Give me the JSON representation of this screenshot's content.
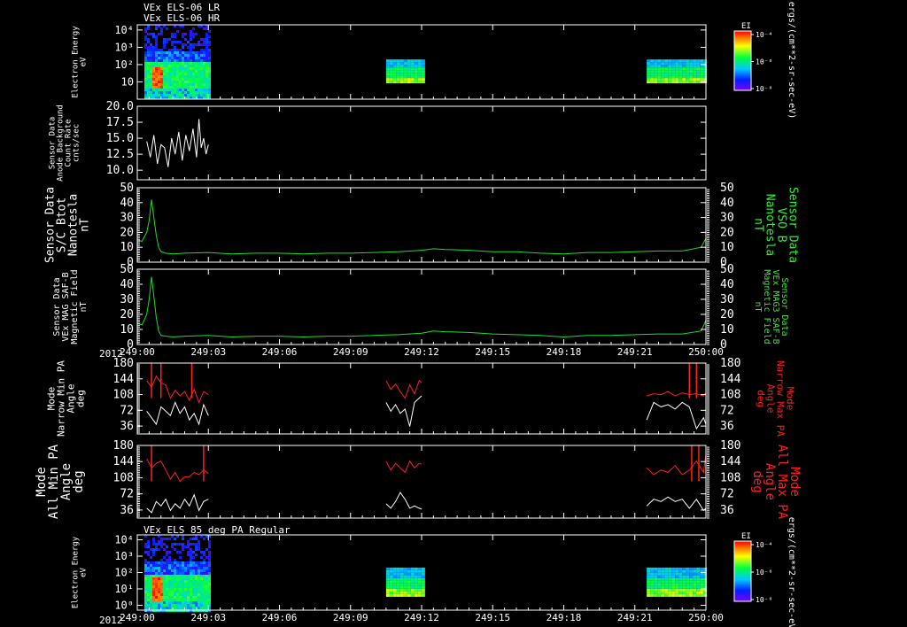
{
  "header": {
    "line1": "VEx ELS-06 LR",
    "line2": "VEx ELS-06 HR",
    "bottom_title": "VEx ELS 85 deg PA Regular"
  },
  "colors": {
    "background": "#000000",
    "axis": "#ffffff",
    "white_trace": "#ffffff",
    "green_trace": "#22dd22",
    "red_trace": "#ff2020",
    "green_label": "#33ee33",
    "red_label": "#ff2020"
  },
  "time_axis": {
    "year": "2012",
    "ticks": [
      "249:00",
      "249:03",
      "249:06",
      "249:09",
      "249:12",
      "249:15",
      "249:18",
      "249:21",
      "250:00"
    ],
    "range_minutes": [
      0,
      24
    ]
  },
  "chart_data": [
    {
      "id": "panel1",
      "type": "heatmap",
      "title": "VEx ELS-06 LR / VEx ELS-06 HR",
      "ylabel": [
        "Electron Energy",
        "eV"
      ],
      "yscale": "log",
      "ylim": [
        1,
        20000
      ],
      "yticks": [
        {
          "v": 10,
          "t": "10"
        },
        {
          "v": 100,
          "t": "10²"
        },
        {
          "v": 1000,
          "t": "10³"
        },
        {
          "v": 10000,
          "t": "10⁴"
        }
      ],
      "blocks": [
        {
          "x": [
            0.3,
            3.0
          ],
          "e": [
            1,
            20000
          ],
          "kind": "dense"
        },
        {
          "x": [
            10.5,
            12.0
          ],
          "e": [
            9,
            200
          ],
          "kind": "band"
        },
        {
          "x": [
            21.5,
            24.0
          ],
          "e": [
            9,
            200
          ],
          "kind": "band"
        }
      ],
      "colorbar": {
        "label": "EI",
        "ticks": [
          "10⁻⁴",
          "10⁻⁶",
          "10⁻⁸"
        ],
        "unit": "ergs/(cm**2-sr-sec-eV)"
      }
    },
    {
      "id": "panel2",
      "type": "line",
      "ylabel": [
        "Sensor Data",
        "Anode Background",
        "Count Rate",
        "cnts/sec"
      ],
      "ylim": [
        8.5,
        20
      ],
      "yticks": [
        {
          "v": 10,
          "t": "10.0"
        },
        {
          "v": 12.5,
          "t": "12.5"
        },
        {
          "v": 15,
          "t": "15.0"
        },
        {
          "v": 17.5,
          "t": "17.5"
        },
        {
          "v": 20,
          "t": "20.0"
        }
      ],
      "series": [
        {
          "color": "white",
          "x": [
            0.4,
            0.55,
            0.7,
            0.85,
            1.0,
            1.15,
            1.3,
            1.45,
            1.6,
            1.75,
            1.9,
            2.05,
            2.2,
            2.35,
            2.5,
            2.6,
            2.7,
            2.8,
            2.9,
            3.0
          ],
          "y": [
            14.5,
            12.0,
            15.5,
            11.0,
            14.0,
            13.5,
            10.5,
            15.0,
            12.5,
            16.0,
            11.5,
            15.5,
            13.0,
            16.5,
            12.0,
            18.0,
            13.5,
            15.0,
            12.5,
            14.0
          ]
        }
      ]
    },
    {
      "id": "panel3",
      "type": "line",
      "ylabel": [
        "Sensor Data",
        "S/C Btot",
        "Nanotesla",
        "nT"
      ],
      "right_label": [
        "Sensor Data",
        "VSO B",
        "Nanotesla",
        "nT"
      ],
      "ylim": [
        0,
        50
      ],
      "yticks": [
        {
          "v": 10,
          "t": "10"
        },
        {
          "v": 20,
          "t": "20"
        },
        {
          "v": 30,
          "t": "30"
        },
        {
          "v": 40,
          "t": "40"
        },
        {
          "v": 50,
          "t": "50"
        }
      ],
      "series": [
        {
          "color": "green",
          "x": [
            0,
            0.2,
            0.4,
            0.5,
            0.6,
            0.7,
            0.8,
            0.9,
            1.0,
            1.2,
            1.5,
            2.0,
            3.0,
            4.0,
            5.0,
            6.0,
            7.0,
            8.0,
            9.0,
            10.0,
            11.0,
            12.0,
            12.5,
            13.0,
            14.0,
            15.0,
            16.0,
            17.0,
            18.0,
            19.0,
            20.0,
            21.0,
            22.0,
            23.0,
            23.8,
            24.0
          ],
          "y": [
            15,
            14,
            20,
            28,
            42,
            30,
            18,
            10,
            7,
            6,
            5.5,
            6,
            6.5,
            5.5,
            6,
            6,
            5.5,
            6,
            6,
            6.5,
            7,
            8,
            9,
            8.5,
            8,
            7,
            7,
            6,
            5.5,
            6.5,
            6.5,
            7,
            7.5,
            7.5,
            10,
            16
          ]
        }
      ]
    },
    {
      "id": "panel4",
      "type": "line",
      "ylabel": [
        "Sensor Data",
        "VEx MAG SAF-B",
        "Magnetic Field",
        "nT"
      ],
      "right_label": [
        "Sensor Data",
        "VEx MAG3 SAF-B",
        "Magnetic Field",
        "nT"
      ],
      "ylim": [
        0,
        50
      ],
      "yticks": [
        {
          "v": 10,
          "t": "10"
        },
        {
          "v": 20,
          "t": "20"
        },
        {
          "v": 30,
          "t": "30"
        },
        {
          "v": 40,
          "t": "40"
        },
        {
          "v": 50,
          "t": "50"
        }
      ],
      "series": [
        {
          "color": "green",
          "x": [
            0,
            0.2,
            0.4,
            0.5,
            0.6,
            0.7,
            0.8,
            0.9,
            1.0,
            1.2,
            1.5,
            2.0,
            3.0,
            4.0,
            5.0,
            6.0,
            7.0,
            8.0,
            9.0,
            10.0,
            11.0,
            12.0,
            12.5,
            13.0,
            14.0,
            15.0,
            16.0,
            17.0,
            18.0,
            19.0,
            20.0,
            21.0,
            22.0,
            23.0,
            23.8,
            24.0
          ],
          "y": [
            14,
            13,
            20,
            30,
            45,
            32,
            18,
            9,
            6,
            5.5,
            5,
            5.5,
            6,
            5,
            5.5,
            5.5,
            5,
            5.5,
            5.5,
            6,
            6.5,
            7.5,
            9,
            8.5,
            8,
            7,
            6.5,
            6,
            5,
            6,
            6,
            6.5,
            7,
            7,
            9,
            16
          ]
        }
      ]
    },
    {
      "id": "panel5",
      "type": "line",
      "ylabel": [
        "Mode",
        "Narrow Min PA",
        "Angle",
        "deg"
      ],
      "right_label": [
        "Mode",
        "Narrow Max PA",
        "Angle",
        "deg"
      ],
      "ylim": [
        18,
        180
      ],
      "yticks": [
        {
          "v": 36,
          "t": "36"
        },
        {
          "v": 72,
          "t": "72"
        },
        {
          "v": 108,
          "t": "108"
        },
        {
          "v": 144,
          "t": "144"
        },
        {
          "v": 180,
          "t": "180"
        }
      ],
      "series": [
        {
          "color": "red",
          "segments": [
            {
              "x": [
                0.4,
                0.6,
                0.8,
                1.0,
                1.2,
                1.4,
                1.6,
                1.8,
                2.0,
                2.2,
                2.4,
                2.6,
                2.8,
                3.0
              ],
              "y": [
                140,
                125,
                150,
                135,
                130,
                100,
                118,
                105,
                115,
                95,
                120,
                90,
                115,
                108
              ]
            },
            {
              "x": [
                10.5,
                10.7,
                10.9,
                11.1,
                11.3,
                11.5,
                11.7,
                11.9,
                12.0
              ],
              "y": [
                140,
                120,
                132,
                115,
                100,
                130,
                110,
                140,
                135
              ]
            },
            {
              "x": [
                21.5,
                21.8,
                22.1,
                22.4,
                22.7,
                23.0,
                23.3,
                23.6,
                23.9,
                24.0
              ],
              "y": [
                105,
                110,
                108,
                115,
                105,
                112,
                108,
                110,
                105,
                112
              ]
            }
          ],
          "spikes": [
            0.6,
            1.0,
            2.3,
            23.3,
            23.6
          ]
        },
        {
          "color": "white",
          "segments": [
            {
              "x": [
                0.4,
                0.6,
                0.8,
                1.0,
                1.2,
                1.4,
                1.6,
                1.8,
                2.0,
                2.2,
                2.4,
                2.6,
                2.8,
                3.0
              ],
              "y": [
                70,
                55,
                40,
                80,
                70,
                60,
                90,
                65,
                80,
                50,
                65,
                40,
                85,
                60
              ]
            },
            {
              "x": [
                10.5,
                10.7,
                10.9,
                11.1,
                11.3,
                11.5,
                11.7,
                11.9,
                12.0
              ],
              "y": [
                90,
                70,
                85,
                65,
                75,
                35,
                90,
                100,
                105
              ]
            },
            {
              "x": [
                21.5,
                21.8,
                22.1,
                22.4,
                22.7,
                23.0,
                23.3,
                23.6,
                23.9,
                24.0
              ],
              "y": [
                50,
                90,
                80,
                85,
                75,
                90,
                80,
                30,
                55,
                40
              ]
            }
          ]
        }
      ]
    },
    {
      "id": "panel6",
      "type": "line",
      "ylabel": [
        "Mode",
        "All Min PA",
        "Angle",
        "deg"
      ],
      "right_label": [
        "Mode",
        "All Max PA",
        "Angle",
        "deg"
      ],
      "ylim": [
        18,
        180
      ],
      "yticks": [
        {
          "v": 36,
          "t": "36"
        },
        {
          "v": 72,
          "t": "72"
        },
        {
          "v": 108,
          "t": "108"
        },
        {
          "v": 144,
          "t": "144"
        },
        {
          "v": 180,
          "t": "180"
        }
      ],
      "series": [
        {
          "color": "red",
          "segments": [
            {
              "x": [
                0.4,
                0.6,
                0.8,
                1.0,
                1.2,
                1.4,
                1.6,
                1.8,
                2.0,
                2.2,
                2.4,
                2.6,
                2.8,
                3.0
              ],
              "y": [
                150,
                130,
                140,
                145,
                125,
                105,
                120,
                100,
                110,
                110,
                120,
                115,
                125,
                118
              ]
            },
            {
              "x": [
                10.5,
                10.7,
                10.9,
                11.1,
                11.3,
                11.5,
                11.7,
                11.9,
                12.0
              ],
              "y": [
                145,
                125,
                140,
                130,
                120,
                145,
                130,
                140,
                138
              ]
            },
            {
              "x": [
                21.5,
                21.8,
                22.1,
                22.4,
                22.7,
                23.0,
                23.3,
                23.6,
                23.9,
                24.0
              ],
              "y": [
                130,
                115,
                125,
                120,
                135,
                115,
                125,
                145,
                120,
                160
              ]
            }
          ],
          "spikes": [
            0.6,
            2.8,
            23.4,
            23.7
          ]
        },
        {
          "color": "white",
          "segments": [
            {
              "x": [
                0.4,
                0.6,
                0.8,
                1.0,
                1.2,
                1.4,
                1.6,
                1.8,
                2.0,
                2.2,
                2.4,
                2.6,
                2.8,
                3.0
              ],
              "y": [
                40,
                30,
                55,
                45,
                60,
                35,
                50,
                40,
                60,
                45,
                70,
                35,
                55,
                60
              ]
            },
            {
              "x": [
                10.5,
                10.7,
                10.9,
                11.1,
                11.3,
                11.5,
                11.7,
                11.9,
                12.0
              ],
              "y": [
                50,
                40,
                55,
                75,
                60,
                40,
                45,
                40,
                38
              ]
            },
            {
              "x": [
                21.5,
                21.8,
                22.1,
                22.4,
                22.7,
                23.0,
                23.3,
                23.6,
                23.9,
                24.0
              ],
              "y": [
                45,
                60,
                55,
                65,
                55,
                60,
                40,
                60,
                35,
                40
              ]
            }
          ]
        }
      ]
    },
    {
      "id": "panel7",
      "type": "heatmap",
      "title": "VEx ELS 85 deg PA Regular",
      "ylabel": [
        "Electron Energy",
        "eV"
      ],
      "yscale": "log",
      "ylim": [
        0.5,
        20000
      ],
      "yticks": [
        {
          "v": 1,
          "t": "10⁰"
        },
        {
          "v": 10,
          "t": "10¹"
        },
        {
          "v": 100,
          "t": "10²"
        },
        {
          "v": 1000,
          "t": "10³"
        },
        {
          "v": 10000,
          "t": "10⁴"
        }
      ],
      "blocks": [
        {
          "x": [
            0.3,
            3.0
          ],
          "e": [
            0.5,
            20000
          ],
          "kind": "dense"
        },
        {
          "x": [
            10.5,
            12.0
          ],
          "e": [
            4,
            200
          ],
          "kind": "band"
        },
        {
          "x": [
            21.5,
            24.0
          ],
          "e": [
            4,
            200
          ],
          "kind": "band"
        }
      ],
      "colorbar": {
        "label": "EI",
        "ticks": [
          "10⁻⁴",
          "10⁻⁶",
          "10⁻⁸"
        ],
        "unit": "ergs/(cm**2-sr-sec-eV)"
      }
    }
  ]
}
